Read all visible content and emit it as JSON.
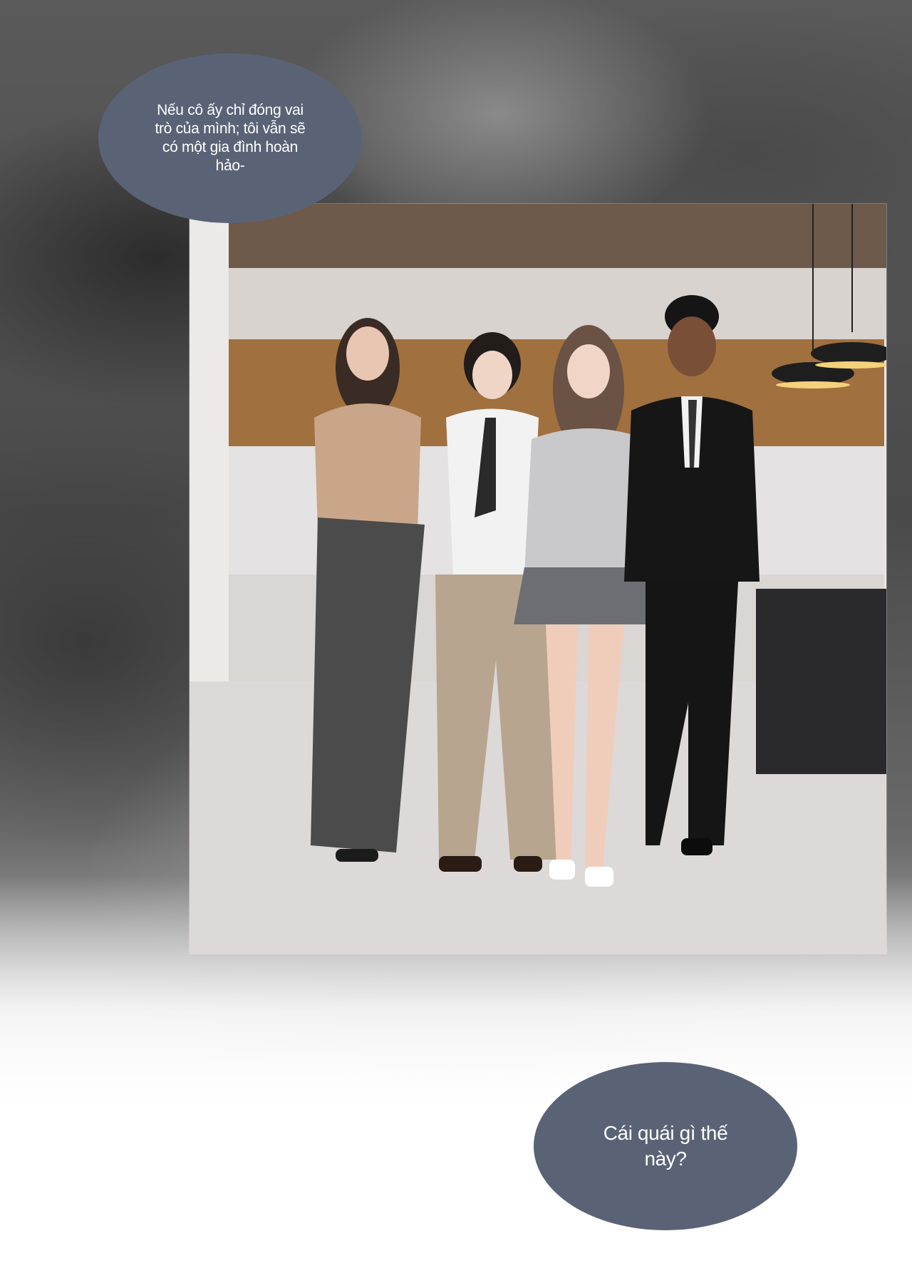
{
  "bubbles": {
    "top": {
      "text": "Nếu cô ấy chỉ đóng vai trò của mình; tôi vẫn sẽ có một gia đình hoàn hảo-"
    },
    "bottom": {
      "text": "Cái quái gì thế này?"
    }
  },
  "colors": {
    "bubble": "#5a6376",
    "bubble_text": "#ffffff",
    "background_dark": "#4a4a4a",
    "background_light": "#ffffff"
  }
}
